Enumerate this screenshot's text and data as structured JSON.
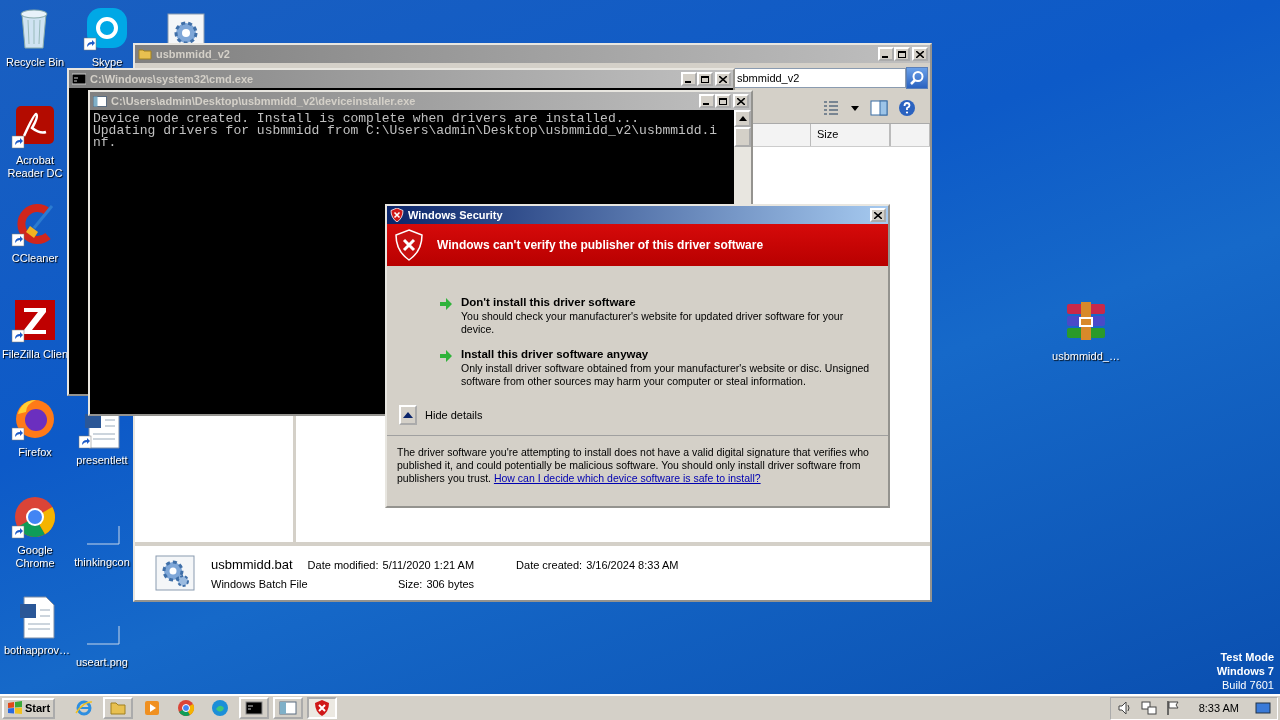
{
  "desktop": {
    "icons": [
      {
        "kind": "recycle-bin",
        "label": "Recycle Bin",
        "shortcut": false
      },
      {
        "kind": "acrobat",
        "label": "Acrobat Reader DC",
        "shortcut": true
      },
      {
        "kind": "ccleaner",
        "label": "CCleaner",
        "shortcut": true
      },
      {
        "kind": "filezilla",
        "label": "FileZilla Clien",
        "shortcut": true
      },
      {
        "kind": "firefox",
        "label": "Firefox",
        "shortcut": true
      },
      {
        "kind": "chrome",
        "label": "Google Chrome",
        "shortcut": true
      },
      {
        "kind": "word-doc",
        "label": "bothapprov…",
        "shortcut": false
      },
      {
        "kind": "skype",
        "label": "Skype",
        "shortcut": true
      },
      {
        "kind": "gear-file",
        "shortcut": false
      },
      {
        "kind": "word-doc",
        "label": "presentlett",
        "shortcut": true
      },
      {
        "kind": "blank-file",
        "label": "thinkingcon",
        "shortcut": false
      },
      {
        "kind": "blank-file",
        "label": "useart.png",
        "shortcut": false
      },
      {
        "kind": "archive",
        "label": "usbmmidd_…",
        "shortcut": false
      }
    ],
    "os_notice": [
      "Test Mode",
      "Windows 7",
      "Build 7601"
    ]
  },
  "explorer": {
    "title": "usbmmidd_v2",
    "address": "sbmmidd_v2",
    "columns": [
      "Size"
    ],
    "details": {
      "file_name": "usbmmidd.bat",
      "file_type": "Windows Batch File",
      "modified_label": "Date modified:",
      "modified": "5/11/2020 1:21 AM",
      "size_label": "Size:",
      "size": "306 bytes",
      "created_label": "Date created:",
      "created": "3/16/2024 8:33 AM"
    }
  },
  "cmd_window": {
    "title": "C:\\Windows\\system32\\cmd.exe"
  },
  "installer_window": {
    "title": "C:\\Users\\admin\\Desktop\\usbmmidd_v2\\deviceinstaller.exe",
    "lines": [
      "Device node created. Install is complete when drivers are installed...",
      "Updating drivers for usbmmidd from C:\\Users\\admin\\Desktop\\usbmmidd_v2\\usbmmidd.i",
      "nf."
    ]
  },
  "dialog": {
    "title": "Windows Security",
    "headline": "Windows can't verify the publisher of this driver software",
    "options": [
      {
        "title": "Don't install this driver software",
        "description": "You should check your manufacturer's website for updated driver software for your device."
      },
      {
        "title": "Install this driver software anyway",
        "description": "Only install driver software obtained from your manufacturer's website or disc. Unsigned software from other sources may harm your computer or steal information."
      }
    ],
    "details_toggle": "Hide details",
    "details_expanded": true,
    "details_text": "The driver software you're attempting to install does not have a valid digital signature that verifies who published it, and could potentially be malicious software.  You should only install driver software from publishers you trust.",
    "details_link": "How can I decide which device software is safe to install?"
  },
  "taskbar": {
    "start": "Start",
    "items": [
      {
        "kind": "ie",
        "open": false,
        "selected": false
      },
      {
        "kind": "explorer",
        "open": true,
        "selected": false
      },
      {
        "kind": "media",
        "open": false,
        "selected": false
      },
      {
        "kind": "chrome",
        "open": false,
        "selected": false
      },
      {
        "kind": "edge",
        "open": false,
        "selected": false
      },
      {
        "kind": "console",
        "open": true,
        "selected": false
      },
      {
        "kind": "window",
        "open": true,
        "selected": false
      },
      {
        "kind": "shield",
        "open": true,
        "selected": true
      }
    ],
    "clock": "8:33 AM"
  }
}
